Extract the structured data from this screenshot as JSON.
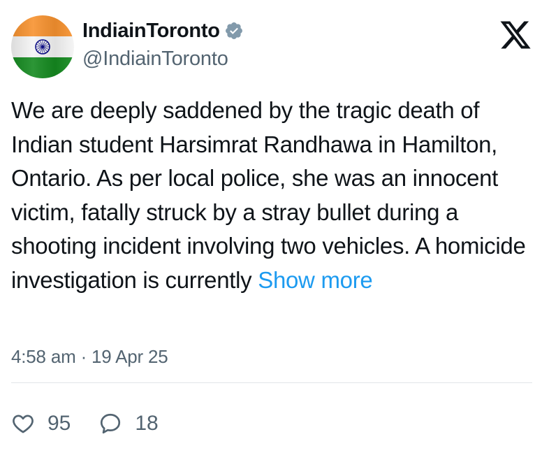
{
  "author": {
    "display_name": "IndiainToronto",
    "handle": "@IndiainToronto",
    "verified": true,
    "avatar_icon": "india-flag-avatar"
  },
  "platform": {
    "logo_icon": "x-logo-icon"
  },
  "tweet": {
    "text": "We are deeply saddened by the tragic death of Indian student Harsimrat Randhawa in Hamilton, Ontario. As per local police, she was an innocent victim, fatally struck by a stray bullet during a shooting incident involving two vehicles. A homicide investigation is currently",
    "show_more_label": "Show more",
    "timestamp": "4:58 am · 19 Apr 25"
  },
  "actions": {
    "likes": {
      "icon": "heart-icon",
      "count": "95"
    },
    "replies": {
      "icon": "reply-bubble-icon",
      "count": "18"
    }
  },
  "colors": {
    "text": "#0f1419",
    "secondary": "#536471",
    "link": "#1d9bf0",
    "verified": "#829aab",
    "saffron": "#ff9933",
    "green": "#138808",
    "chakra": "#000080"
  }
}
